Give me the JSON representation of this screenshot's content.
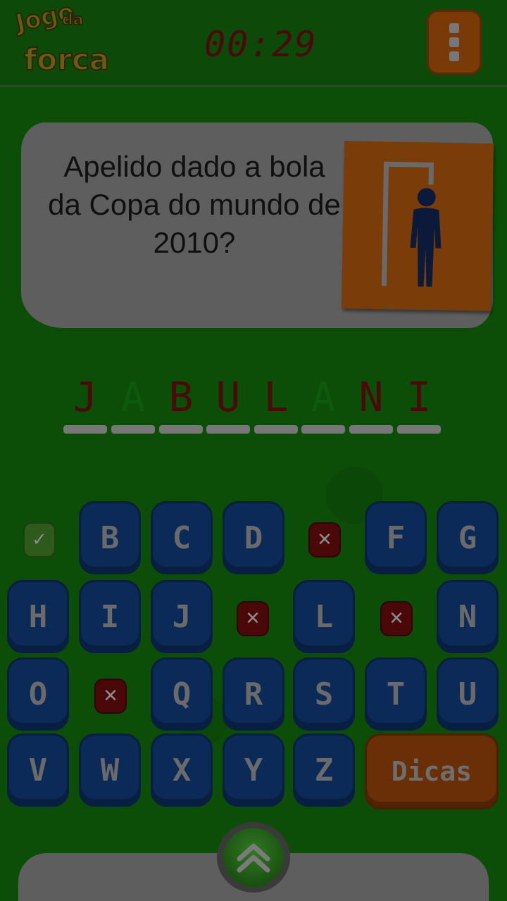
{
  "header": {
    "logo_words": [
      "Jogo",
      "da",
      "forca"
    ],
    "timer": "00:29",
    "menu_icon": "vertical-dots-icon"
  },
  "question": {
    "text": "Apelido dado a bola da Copa do mundo de 2010?",
    "image_icon": "gallows-hangman-icon"
  },
  "word": {
    "letters": [
      {
        "char": "J",
        "state": "revealed",
        "color": "#4a0a0a"
      },
      {
        "char": "A",
        "state": "guessed",
        "color": "#0d5a0d"
      },
      {
        "char": "B",
        "state": "revealed",
        "color": "#4a0a0a"
      },
      {
        "char": "U",
        "state": "revealed",
        "color": "#4a0a0a"
      },
      {
        "char": "L",
        "state": "revealed",
        "color": "#4a0a0a"
      },
      {
        "char": "A",
        "state": "guessed",
        "color": "#0d5a0d"
      },
      {
        "char": "N",
        "state": "revealed",
        "color": "#4a0a0a"
      },
      {
        "char": "I",
        "state": "revealed",
        "color": "#4a0a0a"
      }
    ]
  },
  "keyboard": {
    "row1": [
      "✓",
      "B",
      "C",
      "D",
      "✕",
      "F",
      "G"
    ],
    "row2": [
      "H",
      "I",
      "J",
      "✕",
      "L",
      "✕",
      "N"
    ],
    "row3": [
      "O",
      "✕",
      "Q",
      "R",
      "S",
      "T",
      "U"
    ],
    "row4": [
      "V",
      "W",
      "X",
      "Y",
      "Z"
    ],
    "hints_label": "Dicas"
  },
  "footer": {
    "expand_icon": "double-chevron-up-icon"
  },
  "colors": {
    "background": "#0c4d08",
    "key": "#0b2a58",
    "accent_orange": "#7a3c08",
    "correct": "#2e5a1c",
    "wrong": "#4a0808"
  }
}
